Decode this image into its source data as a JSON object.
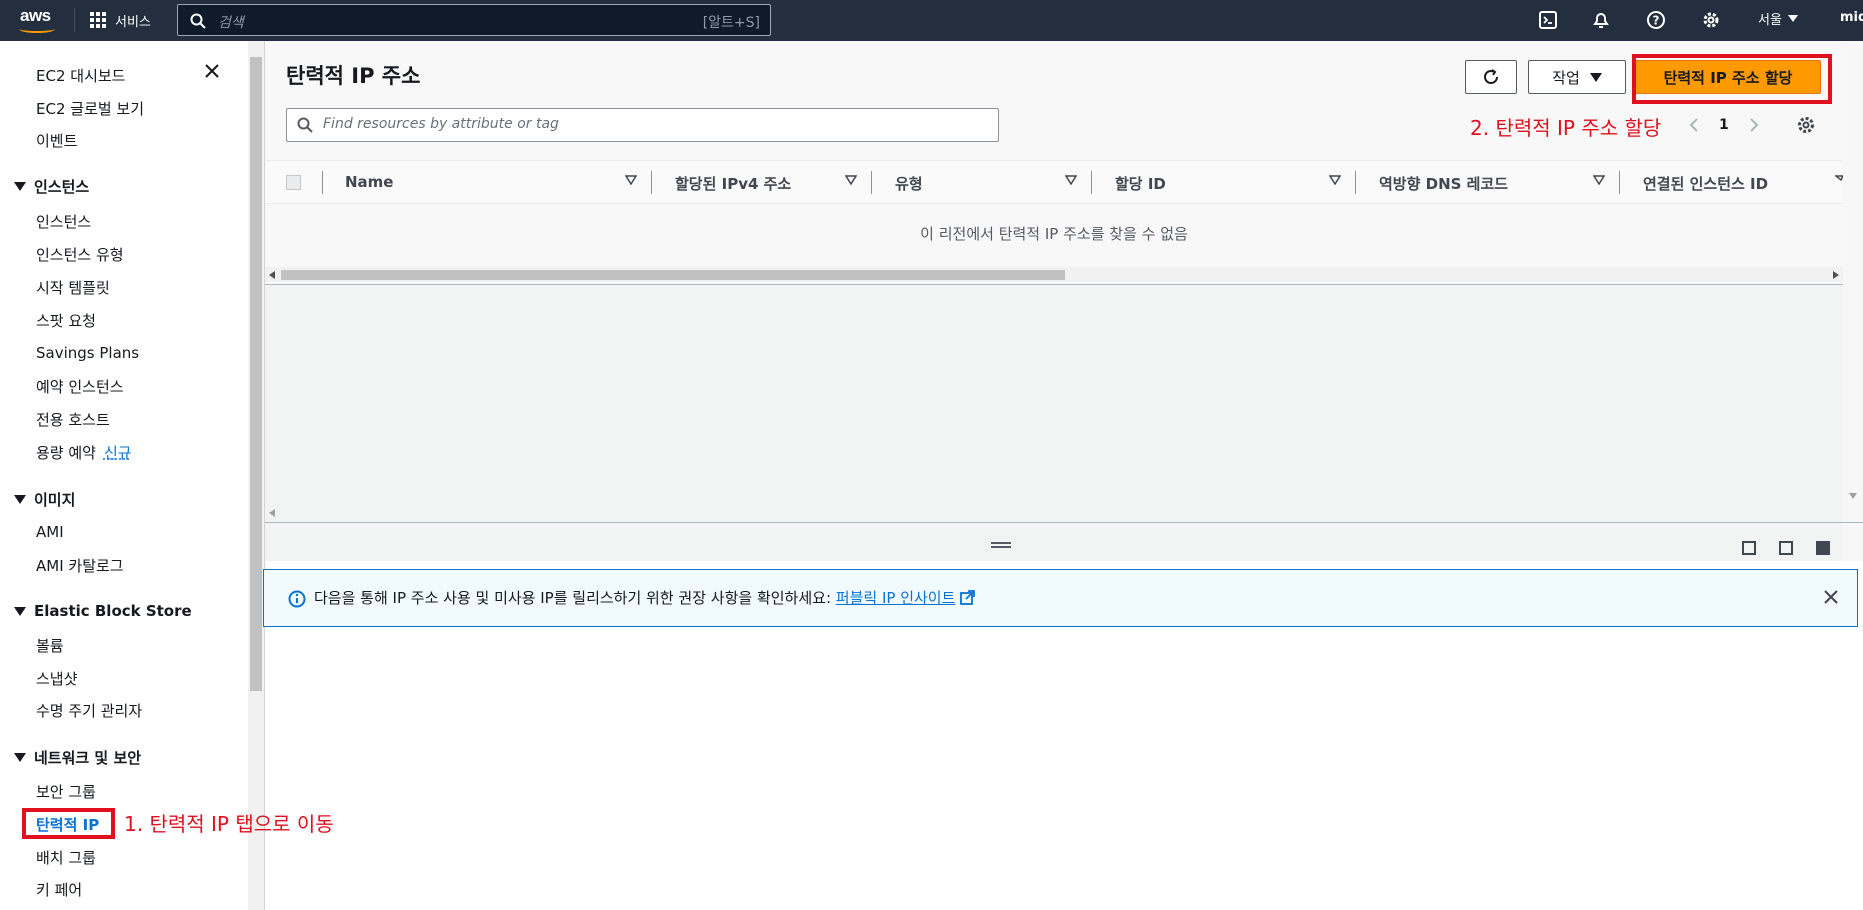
{
  "topbar": {
    "logo": "aws",
    "services_label": "서비스",
    "search_placeholder": "검색",
    "search_shortcut": "[알트+S]",
    "region": "서울",
    "user": "mid",
    "icons": [
      "cloudshell-icon",
      "bell-icon",
      "help-icon",
      "gear-icon"
    ]
  },
  "sidebar": {
    "dashboard": "EC2 대시보드",
    "global_view": "EC2 글로벌 보기",
    "events": "이벤트",
    "sections": [
      {
        "title": "인스턴스",
        "items": [
          "인스턴스",
          "인스턴스 유형",
          "시작 템플릿",
          "스팟 요청",
          "Savings Plans",
          "예약 인스턴스",
          "전용 호스트",
          "용량 예약"
        ]
      },
      {
        "title": "이미지",
        "items": [
          "AMI",
          "AMI 카탈로그"
        ]
      },
      {
        "title": "Elastic Block Store",
        "items": [
          "볼륨",
          "스냅샷",
          "수명 주기 관리자"
        ]
      },
      {
        "title": "네트워크 및 보안",
        "items": [
          "보안 그룹",
          "탄력적 IP",
          "배치 그룹",
          "키 페어"
        ]
      }
    ],
    "new_badge": "신규"
  },
  "main": {
    "title": "탄력적 IP 주소",
    "actions_label": "작업",
    "allocate_label": "탄력적 IP 주소 할당",
    "filter_placeholder": "Find resources by attribute or tag",
    "page_number": "1",
    "columns": [
      "Name",
      "할당된 IPv4 주소",
      "유형",
      "할당 ID",
      "역방향 DNS 레코드",
      "연결된 인스턴스 ID"
    ],
    "empty_message": "이 리전에서 탄력적 IP 주소를 찾을 수 없음",
    "info_message": "다음을 통해 IP 주소 사용 및 미사용 IP를 릴리스하기 위한 권장 사항을 확인하세요:",
    "info_link": "퍼블릭 IP 인사이트"
  },
  "annotations": {
    "step1": "1. 탄력적 IP 탭으로 이동",
    "step2": "2. 탄력적 IP 주소 할당"
  },
  "colors": {
    "topbar": "#232f3e",
    "primary": "#ff9900",
    "link": "#0972d3",
    "annotation": "#e0101e"
  }
}
